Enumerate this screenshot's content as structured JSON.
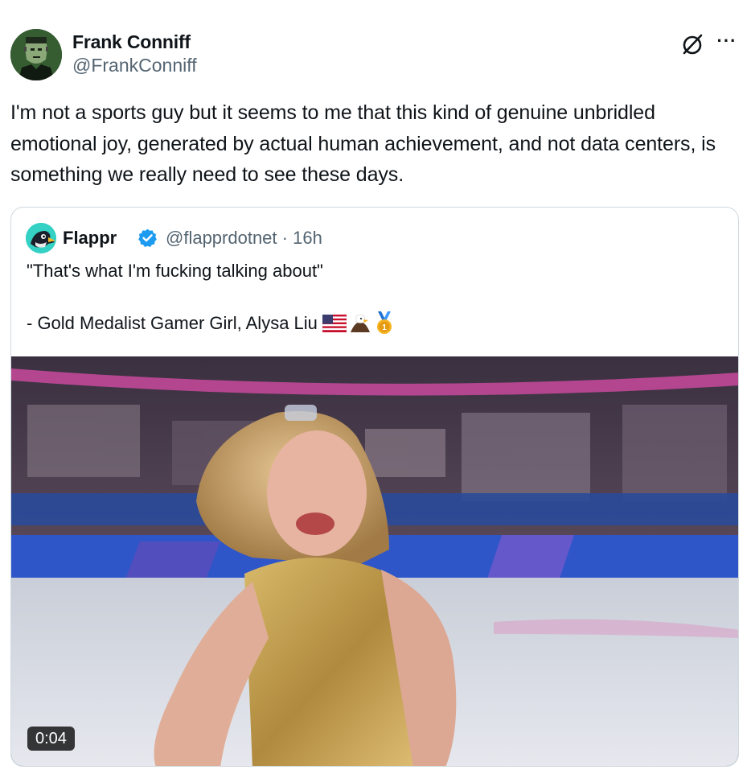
{
  "tweet": {
    "author_name": "Frank Conniff",
    "author_handle": "@FrankConniff",
    "text": "I'm not a sports guy but it seems to me that this kind of genuine unbridled emotional joy, generated by actual human achievement, and not data centers, is something we really need to see these days.",
    "grok_icon": "grok-icon",
    "more_label": "···"
  },
  "quote": {
    "author_name": "Flappr",
    "author_handle": "@flapprdotnet",
    "time": "· 16h",
    "line1": "\"That's what I'm fucking talking about\"",
    "line2": "- Gold Medalist Gamer Girl, Alysa Liu",
    "emojis": [
      "us-flag-icon",
      "eagle-icon",
      "gold-medal-icon"
    ],
    "video_duration": "0:04"
  },
  "colors": {
    "text": "#0f1419",
    "secondary": "#536471",
    "border": "#cfd9de",
    "verified": "#1d9bf0"
  }
}
